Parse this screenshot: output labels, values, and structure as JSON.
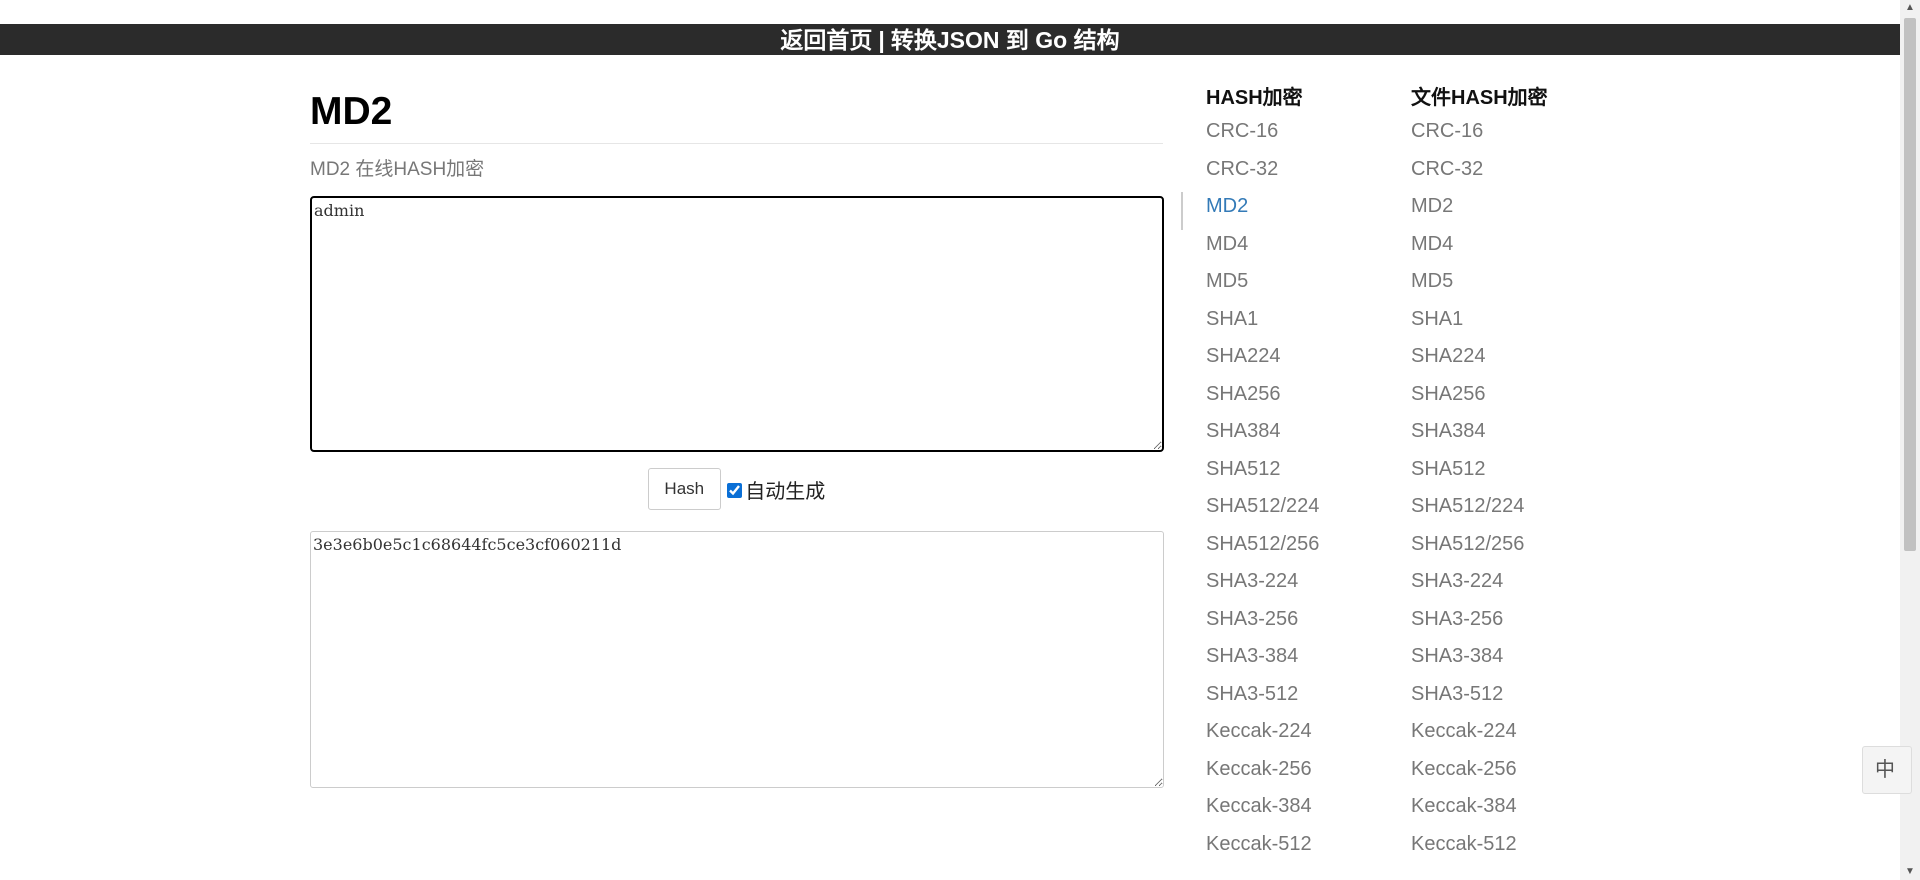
{
  "header": {
    "home_link": "返回首页",
    "separator": "|",
    "json_go_link": "转换JSON 到 Go 结构"
  },
  "main": {
    "title": "MD2",
    "subtitle": "MD2 在线HASH加密",
    "input_value": "admin",
    "hash_button": "Hash",
    "auto_generate_label": "自动生成",
    "auto_generate_checked": true,
    "output_value": "3e3e6b0e5c1c68644fc5ce3cf060211d"
  },
  "sidebar": {
    "hash_column": {
      "heading": "HASH加密",
      "active": "MD2",
      "items": [
        "CRC-16",
        "CRC-32",
        "MD2",
        "MD4",
        "MD5",
        "SHA1",
        "SHA224",
        "SHA256",
        "SHA384",
        "SHA512",
        "SHA512/224",
        "SHA512/256",
        "SHA3-224",
        "SHA3-256",
        "SHA3-384",
        "SHA3-512",
        "Keccak-224",
        "Keccak-256",
        "Keccak-384",
        "Keccak-512"
      ]
    },
    "file_column": {
      "heading": "文件HASH加密",
      "items": [
        "CRC-16",
        "CRC-32",
        "MD2",
        "MD4",
        "MD5",
        "SHA1",
        "SHA224",
        "SHA256",
        "SHA384",
        "SHA512",
        "SHA512/224",
        "SHA512/256",
        "SHA3-224",
        "SHA3-256",
        "SHA3-384",
        "SHA3-512",
        "Keccak-224",
        "Keccak-256",
        "Keccak-384",
        "Keccak-512"
      ]
    }
  },
  "ime_indicator": "中",
  "colors": {
    "header_bg": "#2b2b2b",
    "link_active": "#337ab7",
    "link_muted": "#777777"
  }
}
